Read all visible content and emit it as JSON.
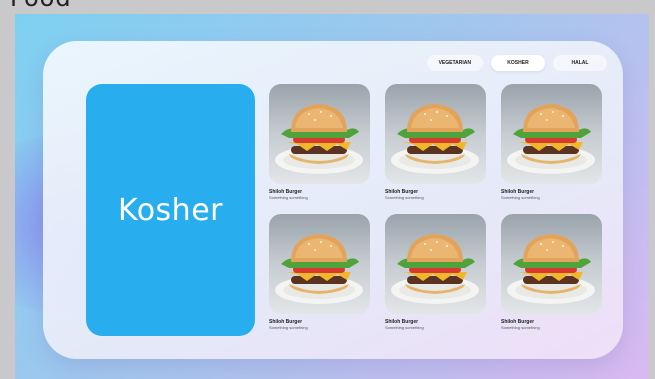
{
  "window": {
    "title": "Food"
  },
  "filters": [
    {
      "label": "Vegetarian",
      "active": false
    },
    {
      "label": "Kosher",
      "active": true
    },
    {
      "label": "Halal",
      "active": false
    }
  ],
  "hero": {
    "title": "Kosher"
  },
  "items": [
    {
      "name": "Shiloh Burger",
      "desc": "Something something",
      "icon": "burger-image"
    },
    {
      "name": "Shiloh Burger",
      "desc": "Something something",
      "icon": "burger-image"
    },
    {
      "name": "Shiloh Burger",
      "desc": "Something something",
      "icon": "burger-image"
    },
    {
      "name": "Shiloh Burger",
      "desc": "Something something",
      "icon": "burger-image"
    },
    {
      "name": "Shiloh Burger",
      "desc": "Something something",
      "icon": "burger-image"
    },
    {
      "name": "Shiloh Burger",
      "desc": "Something something",
      "icon": "burger-image"
    }
  ],
  "colors": {
    "accent": "#28aeee",
    "background": "#c9c9cb"
  }
}
